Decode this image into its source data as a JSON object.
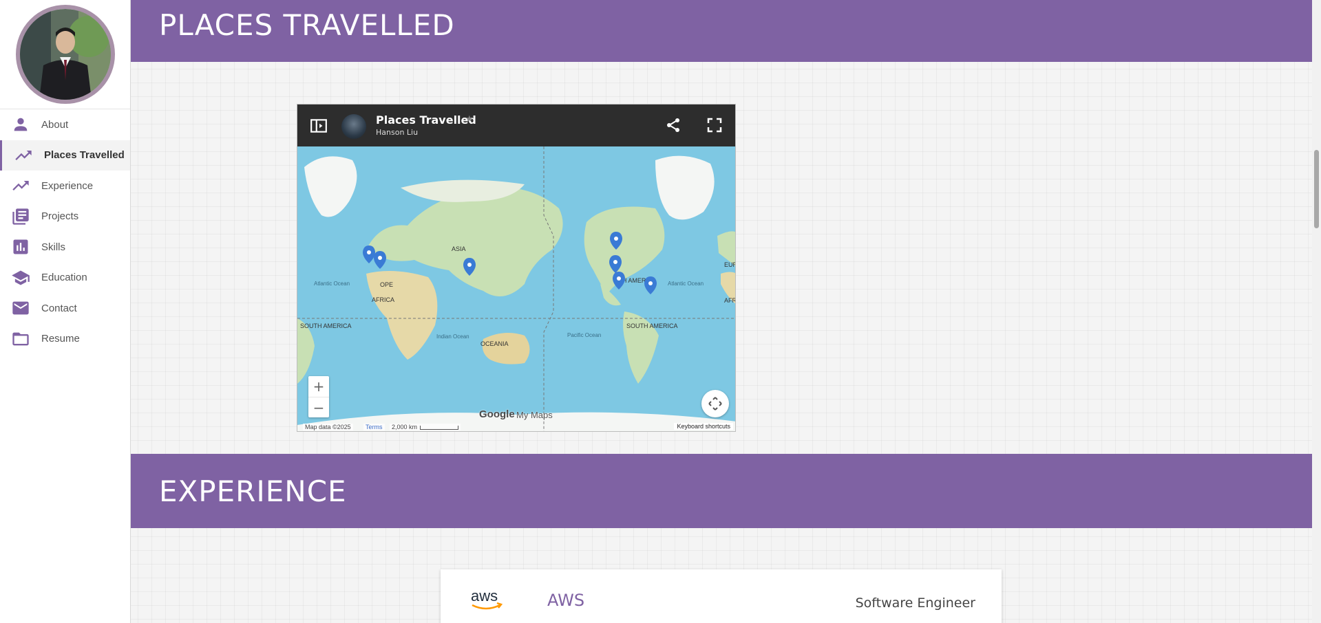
{
  "sidebar": {
    "items": [
      {
        "label": "About",
        "icon": "person-icon"
      },
      {
        "label": "Places Travelled",
        "icon": "trending-up-icon",
        "active": true
      },
      {
        "label": "Experience",
        "icon": "trending-up-icon"
      },
      {
        "label": "Projects",
        "icon": "library-books-icon"
      },
      {
        "label": "Skills",
        "icon": "bar-chart-icon"
      },
      {
        "label": "Education",
        "icon": "school-icon"
      },
      {
        "label": "Contact",
        "icon": "mail-icon"
      },
      {
        "label": "Resume",
        "icon": "folder-icon"
      }
    ]
  },
  "sections": {
    "places": {
      "title": "PLACES TRAVELLED"
    },
    "experience": {
      "title": "EXPERIENCE"
    }
  },
  "map": {
    "title": "Places Travelled",
    "author": "Hanson Liu",
    "star": "★",
    "labels": {
      "asia": "ASIA",
      "europe": "OPE",
      "africa": "AFRICA",
      "north_america": "RTH AMERICA",
      "south_america_left": "SOUTH AMERICA",
      "south_america_right": "SOUTH AMERICA",
      "oceania": "OCEANIA",
      "eur_right": "EUR",
      "afr_right": "AFR",
      "atlantic_left": "Atlantic Ocean",
      "atlantic_right": "Atlantic Ocean",
      "indian": "Indian Ocean",
      "pacific": "Pacific Ocean"
    },
    "zoom_in": "+",
    "zoom_out": "−",
    "google_text": "Google",
    "mymaps_text": "My Maps",
    "footer_data": "Map data ©2025",
    "footer_terms": "Terms",
    "footer_scale": "2,000 km",
    "footer_keyboard": "Keyboard shortcuts"
  },
  "experience": {
    "company": "AWS",
    "logo_text": "aws",
    "role": "Software Engineer"
  },
  "colors": {
    "accent": "#7f62a3",
    "map_water": "#7ec8e3",
    "map_land": "#c8e0b4"
  }
}
